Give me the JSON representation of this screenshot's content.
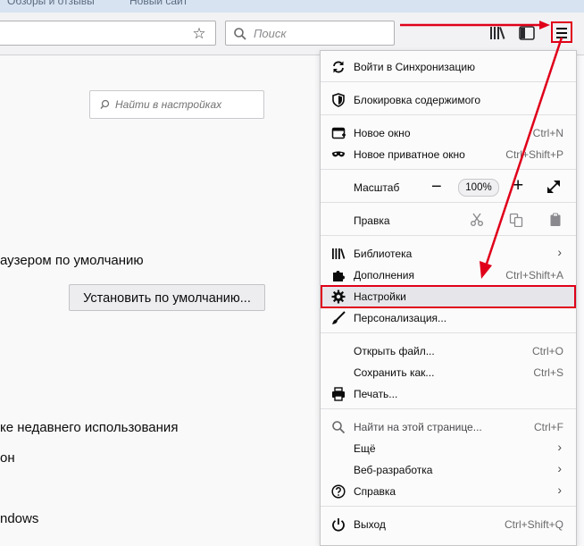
{
  "tabstrip": {
    "tab1": "Обзоры и отзывы",
    "tab2": "Новый сайт"
  },
  "search": {
    "placeholder": "Поиск"
  },
  "prefs": {
    "search_placeholder": "Найти в настройках",
    "default_browser_text": "аузером по умолчанию",
    "set_default_button": "Установить по умолчанию...",
    "recent_use_text": "ке недавнего использования",
    "text_on": "он",
    "text_windows": "ndows"
  },
  "menu": {
    "sync": {
      "label": "Войти в Синхронизацию"
    },
    "content_blocking": {
      "label": "Блокировка содержимого"
    },
    "new_window": {
      "label": "Новое окно",
      "shortcut": "Ctrl+N"
    },
    "private_window": {
      "label": "Новое приватное окно",
      "shortcut": "Ctrl+Shift+P"
    },
    "zoom": {
      "label": "Масштаб",
      "minus": "−",
      "value": "100%",
      "plus": "+"
    },
    "edit": {
      "label": "Правка"
    },
    "library": {
      "label": "Библиотека",
      "chevron": "›"
    },
    "addons": {
      "label": "Дополнения",
      "shortcut": "Ctrl+Shift+A"
    },
    "settings": {
      "label": "Настройки"
    },
    "customize": {
      "label": "Персонализация..."
    },
    "open_file": {
      "label": "Открыть файл...",
      "shortcut": "Ctrl+O"
    },
    "save_as": {
      "label": "Сохранить как...",
      "shortcut": "Ctrl+S"
    },
    "print": {
      "label": "Печать..."
    },
    "find": {
      "label": "Найти на этой странице...",
      "shortcut": "Ctrl+F"
    },
    "more": {
      "label": "Ещё",
      "chevron": "›"
    },
    "webdev": {
      "label": "Веб-разработка",
      "chevron": "›"
    },
    "help": {
      "label": "Справка",
      "chevron": "›"
    },
    "quit": {
      "label": "Выход",
      "shortcut": "Ctrl+Shift+Q"
    }
  },
  "colors": {
    "annotation": "#e0001a",
    "highlight_bg": "#e6e6ea"
  }
}
